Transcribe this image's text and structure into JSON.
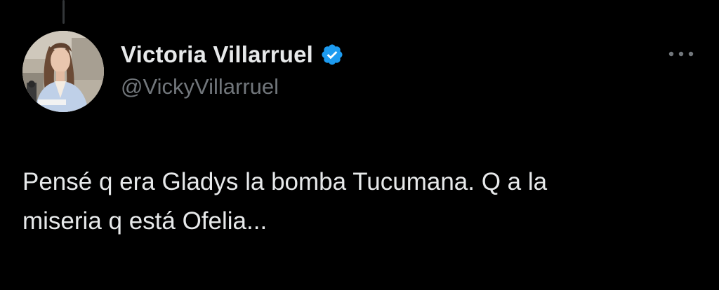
{
  "tweet": {
    "author": {
      "display_name": "Victoria Villarruel",
      "handle": "@VickyVillarruel",
      "verified": true,
      "verified_badge_color": "#1d9bf0"
    },
    "text": "Pensé q era Gladys la bomba Tucumana. Q a la\nmiseria q está Ofelia...",
    "more_icon": "more-horizontal-icon"
  },
  "theme": {
    "background": "#000000",
    "primary_text": "#e7e9ea",
    "secondary_text": "#71767b"
  }
}
